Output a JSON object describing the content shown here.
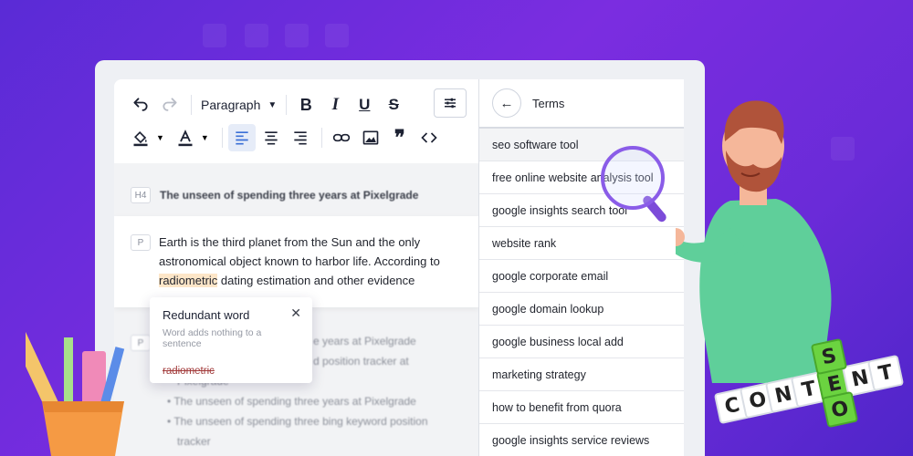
{
  "toolbar": {
    "block_type": "Paragraph"
  },
  "document": {
    "h4_tag": "H4",
    "h4_text": "The unseen of spending three years at Pixelgrade",
    "p_tag": "P",
    "p_text_before": "Earth is the third planet from the Sun and the only astronomical object known to harbor life. According to ",
    "p_highlight": "radiometric",
    "p_text_after": " dating estimation and other evidence",
    "p2_tag": "P",
    "blurred_lines": [
      "e years at Pixelgrade",
      "d position tracker at",
      "Pixelgrade",
      "The unseen of spending three years at Pixelgrade",
      "The unseen of spending three bing keyword position",
      "tracker"
    ]
  },
  "popover": {
    "title": "Redundant word",
    "subtitle": "Word adds nothing to a sentence",
    "word": "radiometric"
  },
  "terms": {
    "title": "Terms",
    "items": [
      "seo software tool",
      "free online website analysis tool",
      "google insights search tool",
      "website rank",
      "google corporate email",
      "google domain lookup",
      "google business local add",
      "marketing strategy",
      "how to benefit from quora",
      "google insights service reviews"
    ]
  },
  "cubes": {
    "content_letters": [
      "C",
      "O",
      "N",
      "T",
      "E",
      "N",
      "T"
    ],
    "seo_letters": [
      "S",
      "E",
      "O"
    ]
  },
  "colors": {
    "background": "#6a2bd8",
    "accent": "#8a5ce8",
    "highlight": "#fde6c8"
  }
}
